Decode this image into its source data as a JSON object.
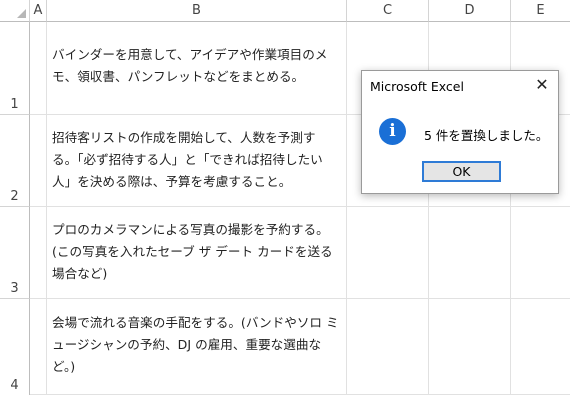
{
  "columns": [
    "A",
    "B",
    "C",
    "D",
    "E"
  ],
  "rows": [
    {
      "number": "1",
      "text": "バインダーを用意して、アイデアや作業項目のメモ、領収書、パンフレットなどをまとめる。"
    },
    {
      "number": "2",
      "text": "招待客リストの作成を開始して、人数を予測する。「必ず招待する人」と「できれば招待したい人」を決める際は、予算を考慮すること。"
    },
    {
      "number": "3",
      "text": "プロのカメラマンによる写真の撮影を予約する。(この写真を入れたセーブ ザ デート カードを送る場合など)"
    },
    {
      "number": "4",
      "text": "会場で流れる音楽の手配をする。(バンドやソロ ミュージシャンの予約、DJ の雇用、重要な選曲など。)"
    }
  ],
  "dialog": {
    "title": "Microsoft Excel",
    "close": "✕",
    "icon": "info-icon",
    "icon_glyph": "i",
    "message": "5 件を置換しました。",
    "ok_label": "OK"
  },
  "colors": {
    "accent": "#1a6fd6",
    "focus": "#2e7bd6"
  }
}
